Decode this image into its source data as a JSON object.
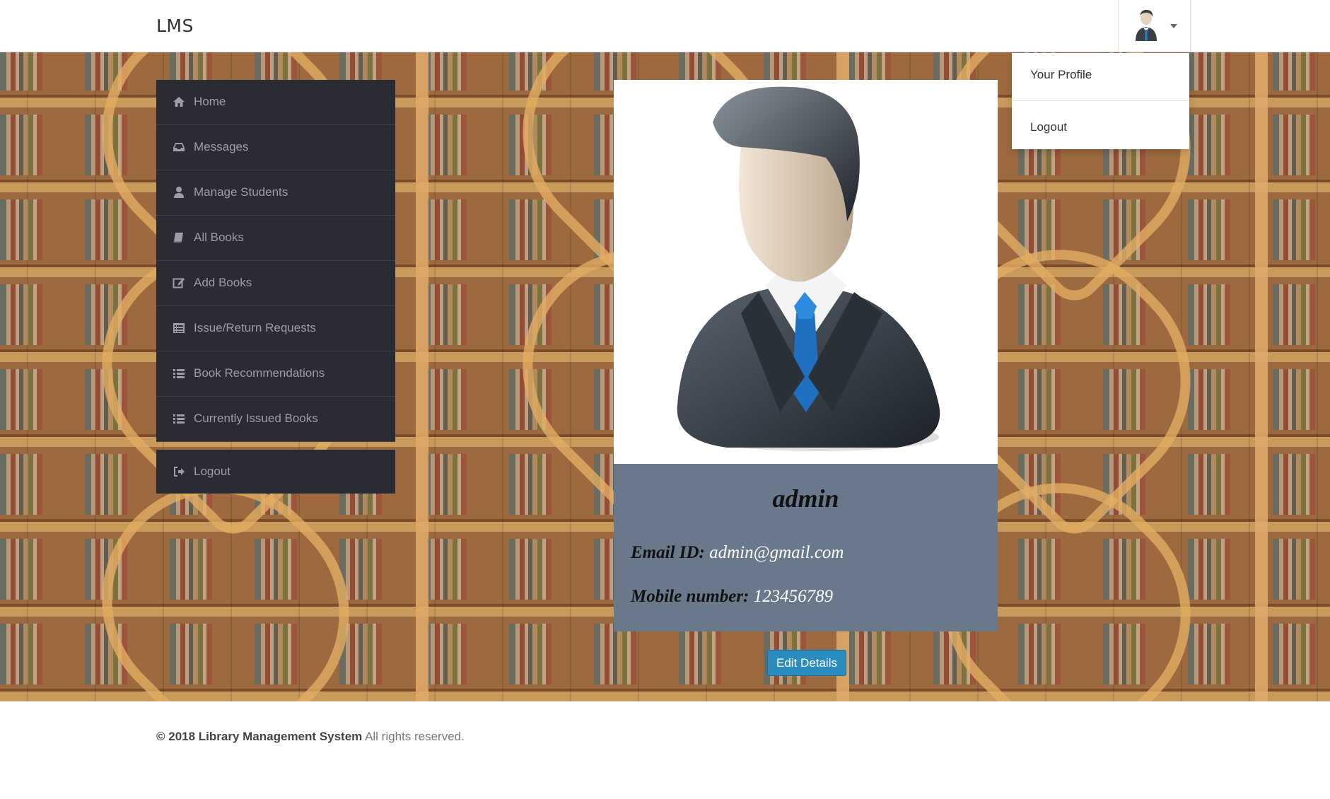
{
  "app": {
    "brand": "LMS"
  },
  "user_menu": {
    "items": [
      {
        "label": "Your Profile"
      },
      {
        "label": "Logout"
      }
    ]
  },
  "sidebar": {
    "items": [
      {
        "label": "Home",
        "icon": "home-icon"
      },
      {
        "label": "Messages",
        "icon": "inbox-icon"
      },
      {
        "label": "Manage Students",
        "icon": "user-icon"
      },
      {
        "label": "All Books",
        "icon": "book-icon"
      },
      {
        "label": "Add Books",
        "icon": "edit-icon"
      },
      {
        "label": "Issue/Return Requests",
        "icon": "list-alt-icon"
      },
      {
        "label": "Book Recommendations",
        "icon": "list-icon"
      },
      {
        "label": "Currently Issued Books",
        "icon": "list-icon"
      }
    ],
    "logout": {
      "label": "Logout",
      "icon": "logout-icon"
    }
  },
  "profile": {
    "name": "admin",
    "email_label": "Email ID:",
    "email": "admin@gmail.com",
    "mobile_label": "Mobile number:",
    "mobile": "123456789",
    "edit_button": "Edit Details"
  },
  "footer": {
    "copyright": "© 2018 Library Management System",
    "rights": "All rights reserved."
  },
  "colors": {
    "sidebar_bg": "#2b2b33",
    "sidebar_text": "#9d9da3",
    "info_panel": "#69798b",
    "button": "#2b8cbf"
  }
}
